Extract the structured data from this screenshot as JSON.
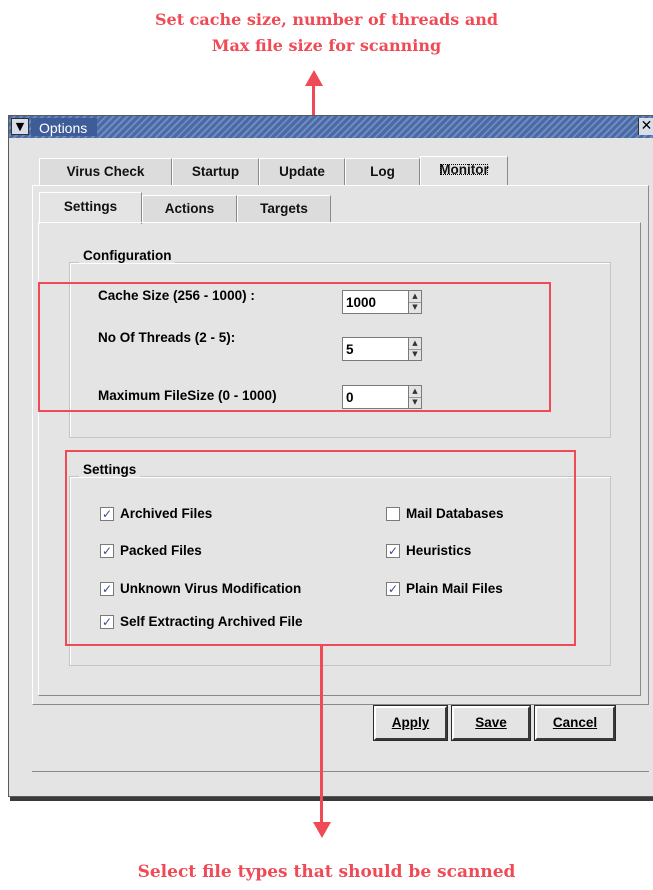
{
  "annotations": {
    "top_line1": "Set cache size, number of threads and",
    "top_line2": "Max file size for scanning",
    "bottom": "Select file types that should be scanned",
    "color": "#ef4a55"
  },
  "window": {
    "title": "Options",
    "menu_icon": "chevron-down-icon",
    "close_icon": "close-icon",
    "titlebar_color": "#4a6aa4"
  },
  "tabs_top": [
    "Virus Check",
    "Startup",
    "Update",
    "Log",
    "Monitor"
  ],
  "tabs_top_active": "Monitor",
  "tabs_sub": [
    "Settings",
    "Actions",
    "Targets"
  ],
  "tabs_sub_active": "Settings",
  "configuration": {
    "title": "Configuration",
    "fields": [
      {
        "label": "Cache Size (256 - 1000) :",
        "value": "1000"
      },
      {
        "label": "No Of Threads (2 - 5):",
        "value": "5"
      },
      {
        "label": "Maximum FileSize (0 - 1000)",
        "value": "0"
      }
    ]
  },
  "settings": {
    "title": "Settings",
    "left": [
      {
        "label": "Archived Files",
        "checked": true
      },
      {
        "label": "Packed Files",
        "checked": true
      },
      {
        "label": "Unknown Virus Modification",
        "checked": true
      },
      {
        "label": "Self Extracting Archived File",
        "checked": true
      }
    ],
    "right": [
      {
        "label": "Mail Databases",
        "checked": false
      },
      {
        "label": "Heuristics",
        "checked": true
      },
      {
        "label": "Plain Mail Files",
        "checked": true
      }
    ]
  },
  "buttons": {
    "apply": "Apply",
    "save": "Save",
    "cancel": "Cancel"
  }
}
